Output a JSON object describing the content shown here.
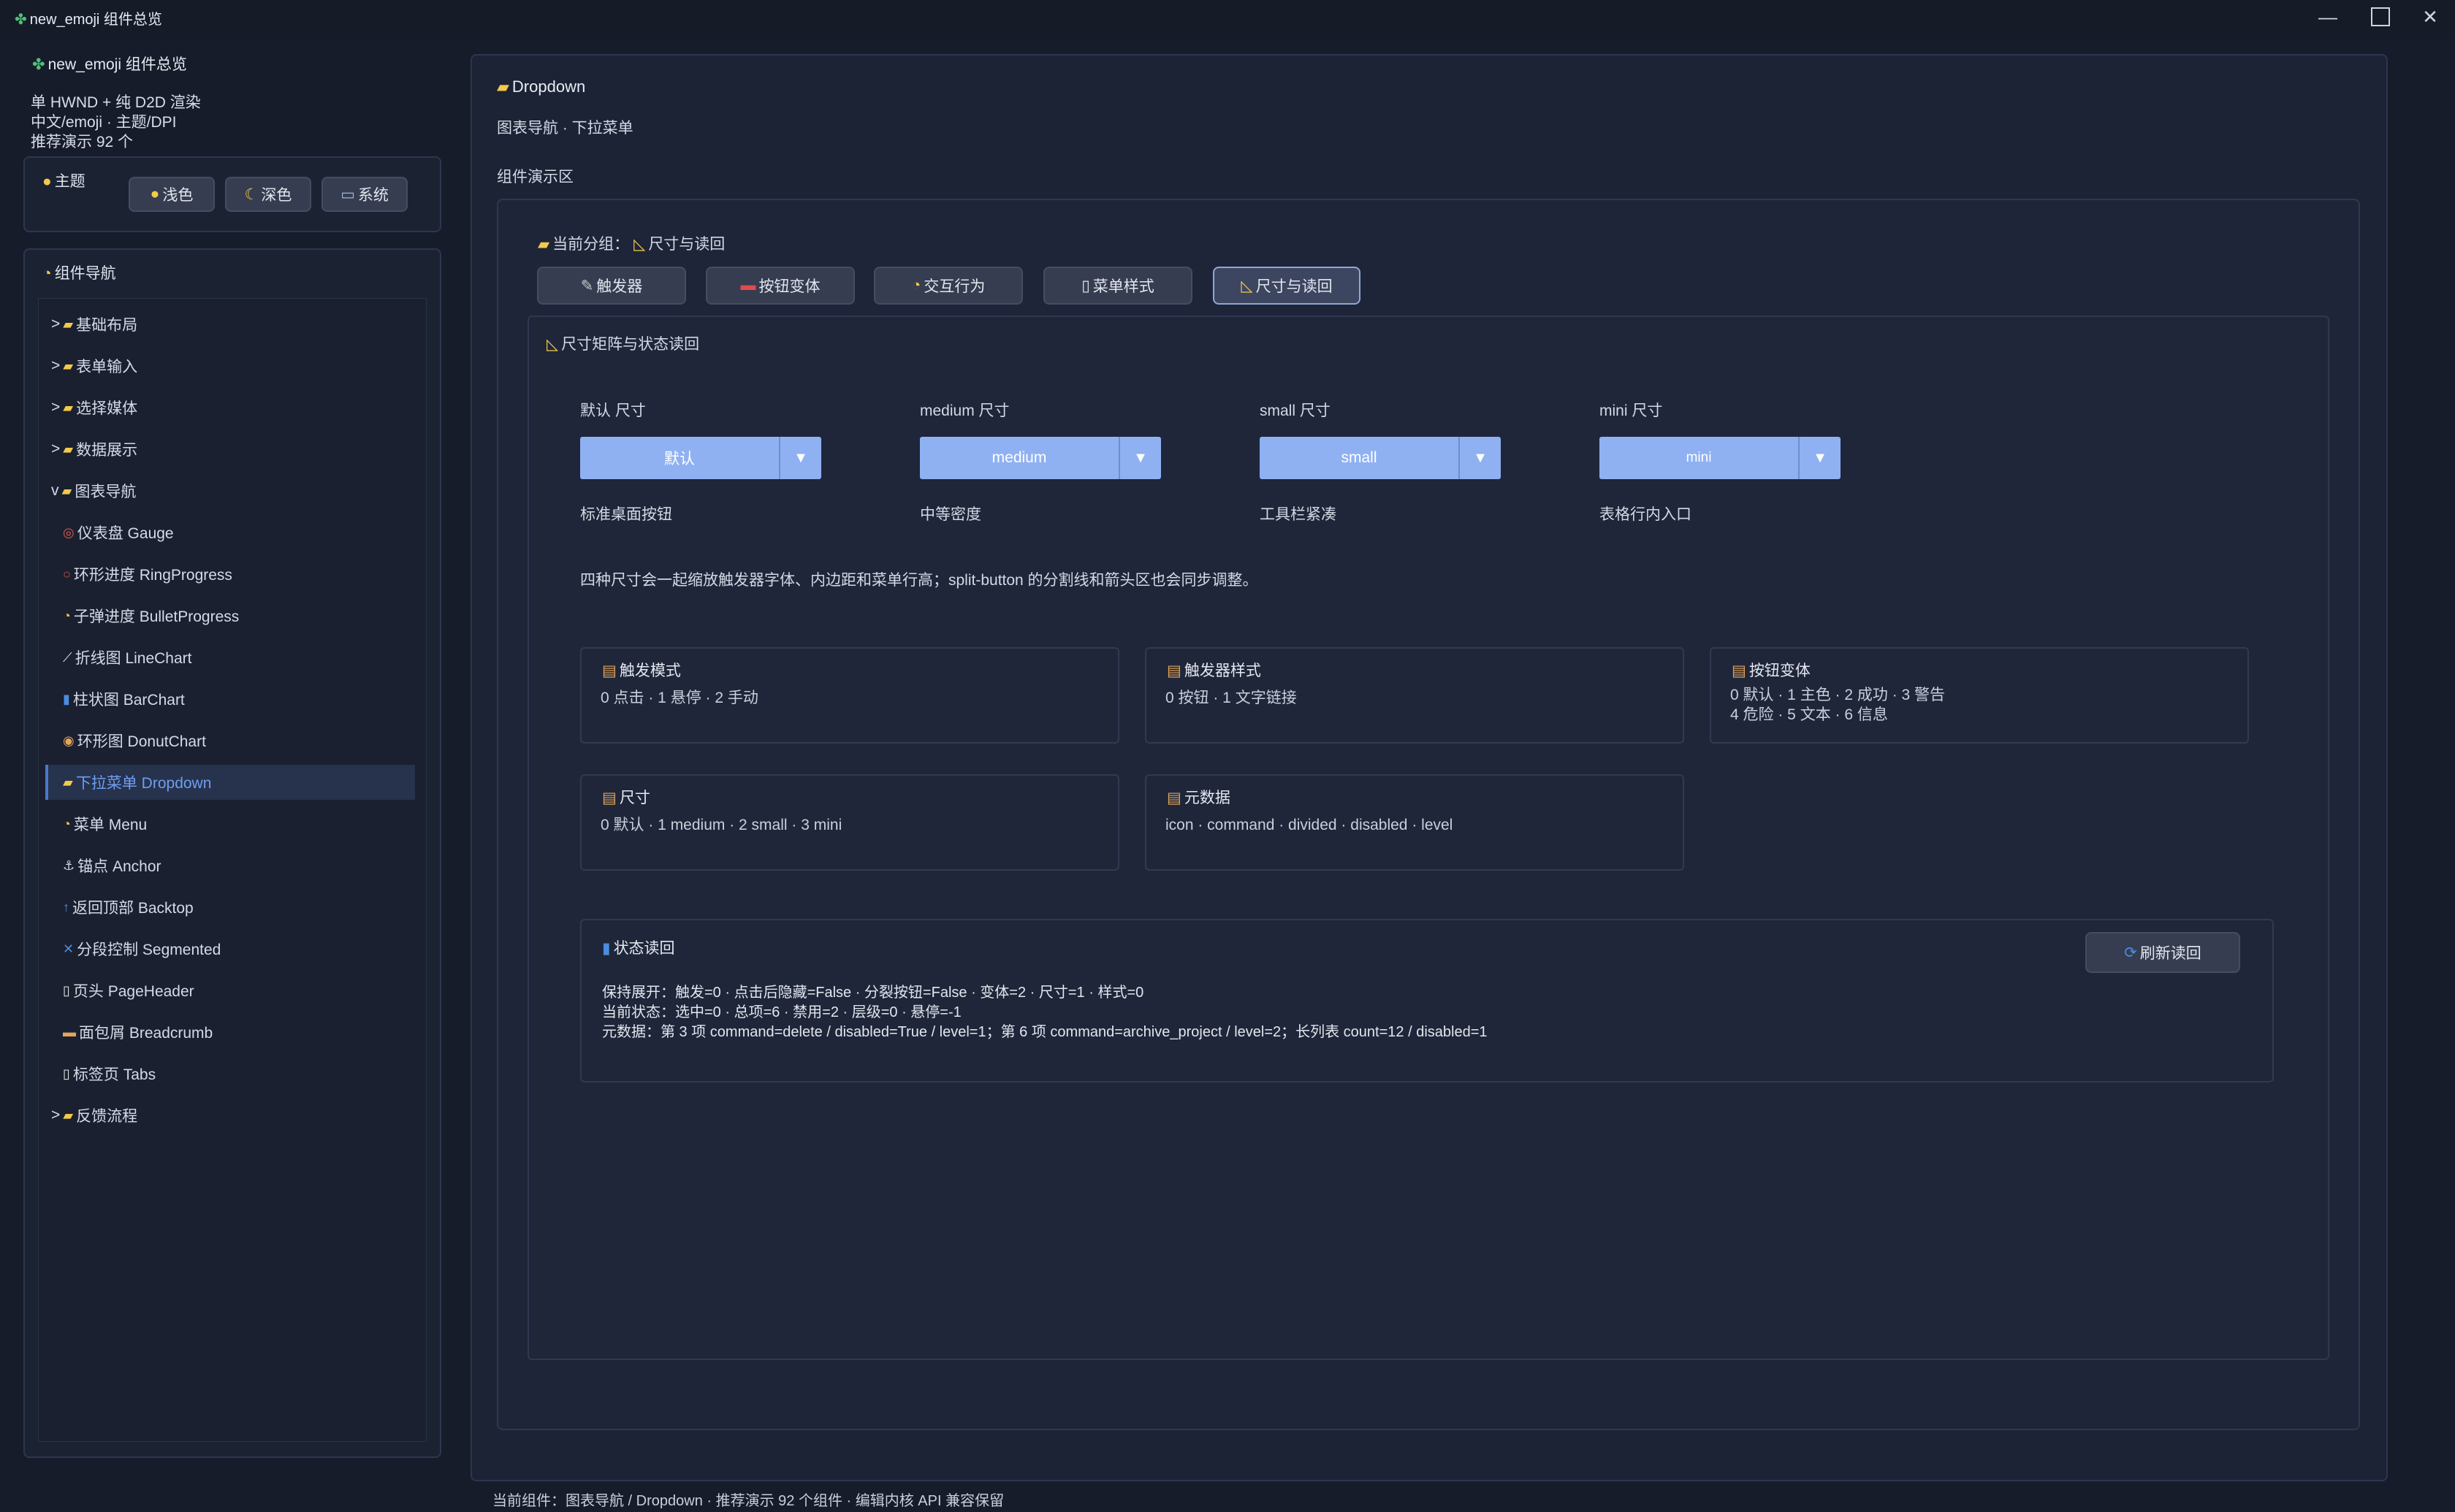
{
  "window": {
    "title": "new_emoji 组件总览",
    "controls": [
      "minimize-icon",
      "maximize-icon",
      "close-icon"
    ]
  },
  "sidebar": {
    "app_title": "new_emoji 组件总览",
    "info_lines": [
      "单 HWND + 纯 D2D 渲染",
      "中文/emoji · 主题/DPI",
      "推荐演示 92 个"
    ],
    "theme": {
      "label": "主题",
      "buttons": [
        "浅色",
        "深色",
        "系统"
      ]
    },
    "nav": {
      "label": "组件导航",
      "items": [
        {
          "prefix": ">",
          "label": "基础布局"
        },
        {
          "prefix": ">",
          "label": "表单输入"
        },
        {
          "prefix": ">",
          "label": "选择媒体"
        },
        {
          "prefix": ">",
          "label": "数据展示"
        },
        {
          "prefix": "v",
          "label": "图表导航"
        },
        {
          "label": "仪表盘 Gauge"
        },
        {
          "label": "环形进度 RingProgress"
        },
        {
          "label": "子弹进度 BulletProgress"
        },
        {
          "label": "折线图 LineChart"
        },
        {
          "label": "柱状图 BarChart"
        },
        {
          "label": "环形图 DonutChart"
        },
        {
          "label": "下拉菜单 Dropdown"
        },
        {
          "label": "菜单 Menu"
        },
        {
          "label": "锚点 Anchor"
        },
        {
          "label": "返回顶部 Backtop"
        },
        {
          "label": "分段控制 Segmented"
        },
        {
          "label": "页头 PageHeader"
        },
        {
          "label": "面包屑 Breadcrumb"
        },
        {
          "label": "标签页 Tabs"
        },
        {
          "prefix": ">",
          "label": "反馈流程"
        }
      ]
    }
  },
  "main": {
    "title": "Dropdown",
    "subtitle": "图表导航 · 下拉菜单",
    "demo_area_label": "组件演示区",
    "group_label": "当前分组：",
    "group_value": "尺寸与读回",
    "tabs": [
      "触发器",
      "按钮变体",
      "交互行为",
      "菜单样式",
      "尺寸与读回"
    ],
    "section_title": "尺寸矩阵与状态读回",
    "sizes": [
      {
        "label": "默认 尺寸",
        "value": "默认",
        "desc": "标准桌面按钮"
      },
      {
        "label": "medium 尺寸",
        "value": "medium",
        "desc": "中等密度"
      },
      {
        "label": "small 尺寸",
        "value": "small",
        "desc": "工具栏紧凑"
      },
      {
        "label": "mini 尺寸",
        "value": "mini",
        "desc": "表格行内入口"
      }
    ],
    "dropdown_arrow": "▼",
    "note": "四种尺寸会一起缩放触发器字体、内边距和菜单行高；split-button 的分割线和箭头区也会同步调整。",
    "cards": [
      {
        "title": "触发模式",
        "body": "0 点击 · 1 悬停 · 2 手动"
      },
      {
        "title": "触发器样式",
        "body": "0 按钮 · 1 文字链接"
      },
      {
        "title": "按钮变体",
        "body": "0 默认 · 1 主色 · 2 成功 · 3 警告\n4 危险 · 5 文本 · 6 信息"
      },
      {
        "title": "尺寸",
        "body": "0 默认 · 1 medium · 2 small · 3 mini"
      },
      {
        "title": "元数据",
        "body": "icon · command · divided · disabled · level"
      }
    ],
    "status": {
      "title": "状态读回",
      "refresh_button": "刷新读回",
      "lines": [
        "保持展开：触发=0 · 点击后隐藏=False · 分裂按钮=False · 变体=2 · 尺寸=1 · 样式=0",
        "当前状态：选中=0 · 总项=6 · 禁用=2 · 层级=0 · 悬停=-1",
        "元数据：第 3 项 command=delete / disabled=True / level=1；第 6 项 command=archive_project / level=2；长列表 count=12 / disabled=1"
      ]
    }
  },
  "footer": {
    "status": "当前组件：图表导航 / Dropdown · 推荐演示 92 个组件 · 编辑内核 API 兼容保留"
  }
}
